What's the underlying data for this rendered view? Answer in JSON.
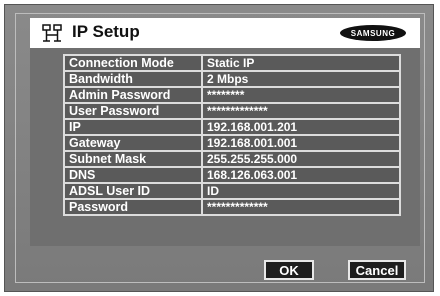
{
  "dialog": {
    "title": "IP Setup",
    "brand": "SAMSUNG",
    "icon": "network-setup-icon"
  },
  "settings": [
    {
      "label": "Connection Mode",
      "value": "Static IP"
    },
    {
      "label": "Bandwidth",
      "value": "2 Mbps"
    },
    {
      "label": "Admin Password",
      "value": "********"
    },
    {
      "label": "User Password",
      "value": "*************"
    },
    {
      "label": "IP",
      "value": "192.168.001.201"
    },
    {
      "label": "Gateway",
      "value": "192.168.001.001"
    },
    {
      "label": "Subnet Mask",
      "value": "255.255.255.000"
    },
    {
      "label": "DNS",
      "value": "168.126.063.001"
    },
    {
      "label": "ADSL User ID",
      "value": "ID"
    },
    {
      "label": "Password",
      "value": "*************"
    }
  ],
  "buttons": {
    "ok": "OK",
    "cancel": "Cancel"
  },
  "colors": {
    "panel": "#6f6f6f",
    "cell": "#5a5a5a",
    "button": "#1e1e1e"
  }
}
